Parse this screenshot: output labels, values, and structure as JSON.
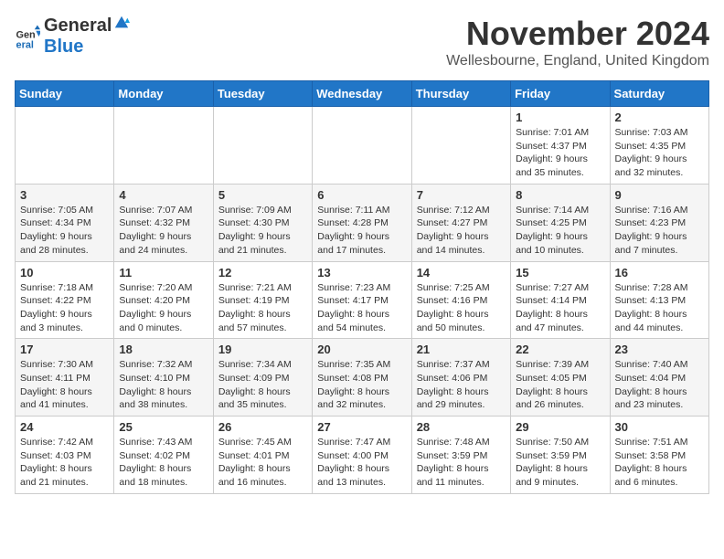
{
  "logo": {
    "line1": "General",
    "line2": "Blue"
  },
  "title": "November 2024",
  "subtitle": "Wellesbourne, England, United Kingdom",
  "weekdays": [
    "Sunday",
    "Monday",
    "Tuesday",
    "Wednesday",
    "Thursday",
    "Friday",
    "Saturday"
  ],
  "weeks": [
    [
      {
        "day": "",
        "info": ""
      },
      {
        "day": "",
        "info": ""
      },
      {
        "day": "",
        "info": ""
      },
      {
        "day": "",
        "info": ""
      },
      {
        "day": "",
        "info": ""
      },
      {
        "day": "1",
        "info": "Sunrise: 7:01 AM\nSunset: 4:37 PM\nDaylight: 9 hours\nand 35 minutes."
      },
      {
        "day": "2",
        "info": "Sunrise: 7:03 AM\nSunset: 4:35 PM\nDaylight: 9 hours\nand 32 minutes."
      }
    ],
    [
      {
        "day": "3",
        "info": "Sunrise: 7:05 AM\nSunset: 4:34 PM\nDaylight: 9 hours\nand 28 minutes."
      },
      {
        "day": "4",
        "info": "Sunrise: 7:07 AM\nSunset: 4:32 PM\nDaylight: 9 hours\nand 24 minutes."
      },
      {
        "day": "5",
        "info": "Sunrise: 7:09 AM\nSunset: 4:30 PM\nDaylight: 9 hours\nand 21 minutes."
      },
      {
        "day": "6",
        "info": "Sunrise: 7:11 AM\nSunset: 4:28 PM\nDaylight: 9 hours\nand 17 minutes."
      },
      {
        "day": "7",
        "info": "Sunrise: 7:12 AM\nSunset: 4:27 PM\nDaylight: 9 hours\nand 14 minutes."
      },
      {
        "day": "8",
        "info": "Sunrise: 7:14 AM\nSunset: 4:25 PM\nDaylight: 9 hours\nand 10 minutes."
      },
      {
        "day": "9",
        "info": "Sunrise: 7:16 AM\nSunset: 4:23 PM\nDaylight: 9 hours\nand 7 minutes."
      }
    ],
    [
      {
        "day": "10",
        "info": "Sunrise: 7:18 AM\nSunset: 4:22 PM\nDaylight: 9 hours\nand 3 minutes."
      },
      {
        "day": "11",
        "info": "Sunrise: 7:20 AM\nSunset: 4:20 PM\nDaylight: 9 hours\nand 0 minutes."
      },
      {
        "day": "12",
        "info": "Sunrise: 7:21 AM\nSunset: 4:19 PM\nDaylight: 8 hours\nand 57 minutes."
      },
      {
        "day": "13",
        "info": "Sunrise: 7:23 AM\nSunset: 4:17 PM\nDaylight: 8 hours\nand 54 minutes."
      },
      {
        "day": "14",
        "info": "Sunrise: 7:25 AM\nSunset: 4:16 PM\nDaylight: 8 hours\nand 50 minutes."
      },
      {
        "day": "15",
        "info": "Sunrise: 7:27 AM\nSunset: 4:14 PM\nDaylight: 8 hours\nand 47 minutes."
      },
      {
        "day": "16",
        "info": "Sunrise: 7:28 AM\nSunset: 4:13 PM\nDaylight: 8 hours\nand 44 minutes."
      }
    ],
    [
      {
        "day": "17",
        "info": "Sunrise: 7:30 AM\nSunset: 4:11 PM\nDaylight: 8 hours\nand 41 minutes."
      },
      {
        "day": "18",
        "info": "Sunrise: 7:32 AM\nSunset: 4:10 PM\nDaylight: 8 hours\nand 38 minutes."
      },
      {
        "day": "19",
        "info": "Sunrise: 7:34 AM\nSunset: 4:09 PM\nDaylight: 8 hours\nand 35 minutes."
      },
      {
        "day": "20",
        "info": "Sunrise: 7:35 AM\nSunset: 4:08 PM\nDaylight: 8 hours\nand 32 minutes."
      },
      {
        "day": "21",
        "info": "Sunrise: 7:37 AM\nSunset: 4:06 PM\nDaylight: 8 hours\nand 29 minutes."
      },
      {
        "day": "22",
        "info": "Sunrise: 7:39 AM\nSunset: 4:05 PM\nDaylight: 8 hours\nand 26 minutes."
      },
      {
        "day": "23",
        "info": "Sunrise: 7:40 AM\nSunset: 4:04 PM\nDaylight: 8 hours\nand 23 minutes."
      }
    ],
    [
      {
        "day": "24",
        "info": "Sunrise: 7:42 AM\nSunset: 4:03 PM\nDaylight: 8 hours\nand 21 minutes."
      },
      {
        "day": "25",
        "info": "Sunrise: 7:43 AM\nSunset: 4:02 PM\nDaylight: 8 hours\nand 18 minutes."
      },
      {
        "day": "26",
        "info": "Sunrise: 7:45 AM\nSunset: 4:01 PM\nDaylight: 8 hours\nand 16 minutes."
      },
      {
        "day": "27",
        "info": "Sunrise: 7:47 AM\nSunset: 4:00 PM\nDaylight: 8 hours\nand 13 minutes."
      },
      {
        "day": "28",
        "info": "Sunrise: 7:48 AM\nSunset: 3:59 PM\nDaylight: 8 hours\nand 11 minutes."
      },
      {
        "day": "29",
        "info": "Sunrise: 7:50 AM\nSunset: 3:59 PM\nDaylight: 8 hours\nand 9 minutes."
      },
      {
        "day": "30",
        "info": "Sunrise: 7:51 AM\nSunset: 3:58 PM\nDaylight: 8 hours\nand 6 minutes."
      }
    ]
  ]
}
